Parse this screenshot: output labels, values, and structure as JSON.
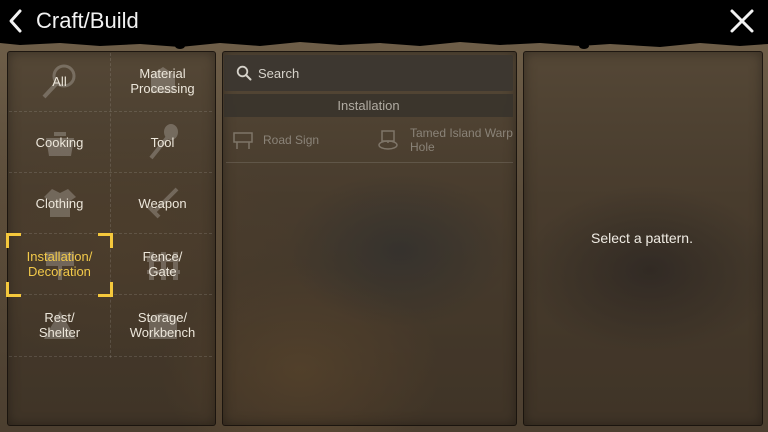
{
  "header": {
    "title": "Craft/Build"
  },
  "categories": [
    {
      "label": "All",
      "icon": "magnifier-icon"
    },
    {
      "label": "Material\nProcessing",
      "icon": "material-icon"
    },
    {
      "label": "Cooking",
      "icon": "pot-icon"
    },
    {
      "label": "Tool",
      "icon": "shovel-icon"
    },
    {
      "label": "Clothing",
      "icon": "shirt-icon"
    },
    {
      "label": "Weapon",
      "icon": "sword-icon"
    },
    {
      "label": "Installation/\nDecoration",
      "icon": "sign-icon",
      "selected": true
    },
    {
      "label": "Fence/\nGate",
      "icon": "fence-icon"
    },
    {
      "label": "Rest/\nShelter",
      "icon": "tent-icon"
    },
    {
      "label": "Storage/\nWorkbench",
      "icon": "chest-icon"
    }
  ],
  "search": {
    "placeholder": "Search"
  },
  "list": {
    "section_title": "Installation",
    "items": [
      {
        "label": "Road Sign",
        "icon": "road-sign-icon"
      },
      {
        "label": "Tamed Island Warp\nHole",
        "icon": "warp-hole-icon"
      }
    ]
  },
  "detail": {
    "message": "Select a pattern."
  },
  "colors": {
    "selected_accent": "#f5c83c",
    "text_primary": "#ece6da",
    "text_dim": "#8a8378"
  }
}
